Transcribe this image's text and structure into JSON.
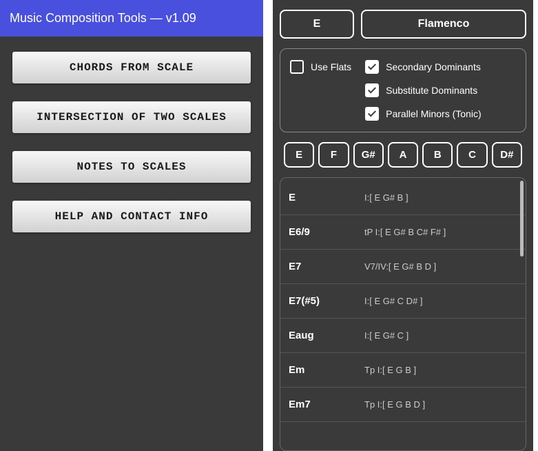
{
  "left": {
    "header_title": "Music Composition Tools — v1.09",
    "buttons": [
      "CHORDS FROM SCALE",
      "INTERSECTION OF TWO SCALES",
      "NOTES TO SCALES",
      "HELP AND CONTACT INFO"
    ]
  },
  "right": {
    "key_button": "E",
    "scale_button": "Flamenco",
    "options": {
      "use_flats": {
        "label": "Use Flats",
        "checked": false
      },
      "secondary_dominants": {
        "label": "Secondary Dominants",
        "checked": true
      },
      "substitute_dominants": {
        "label": "Substitute Dominants",
        "checked": true
      },
      "parallel_minors": {
        "label": "Parallel Minors (Tonic)",
        "checked": true
      }
    },
    "notes": [
      "E",
      "F",
      "G#",
      "A",
      "B",
      "C",
      "D#"
    ],
    "chords": [
      {
        "name": "E",
        "detail": "I:[ E  G#  B ]"
      },
      {
        "name": "E6/9",
        "detail": "tP I:[ E  G#  B  C#  F# ]"
      },
      {
        "name": "E7",
        "detail": "V7/IV:[ E  G#  B  D ]"
      },
      {
        "name": "E7(#5)",
        "detail": "I:[ E  G#  C  D# ]"
      },
      {
        "name": "Eaug",
        "detail": "I:[ E  G#  C ]"
      },
      {
        "name": "Em",
        "detail": "Tp I:[ E  G  B ]"
      },
      {
        "name": "Em7",
        "detail": "Tp I:[ E  G  B  D ]"
      }
    ]
  }
}
